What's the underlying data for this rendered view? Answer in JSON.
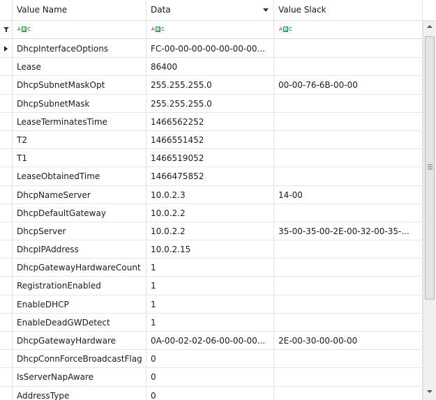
{
  "header": {
    "col_value_name": "Value Name",
    "col_data": "Data",
    "col_value_slack": "Value Slack"
  },
  "filter": {
    "letters": [
      "A",
      "B",
      "C"
    ]
  },
  "rows": [
    {
      "name": "DhcpInterfaceOptions",
      "data": "FC-00-00-00-00-00-00-00...",
      "slack": ""
    },
    {
      "name": "Lease",
      "data": "86400",
      "slack": ""
    },
    {
      "name": "DhcpSubnetMaskOpt",
      "data": "255.255.255.0",
      "slack": "00-00-76-6B-00-00"
    },
    {
      "name": "DhcpSubnetMask",
      "data": "255.255.255.0",
      "slack": ""
    },
    {
      "name": "LeaseTerminatesTime",
      "data": "1466562252",
      "slack": ""
    },
    {
      "name": "T2",
      "data": "1466551452",
      "slack": ""
    },
    {
      "name": "T1",
      "data": "1466519052",
      "slack": ""
    },
    {
      "name": "LeaseObtainedTime",
      "data": "1466475852",
      "slack": ""
    },
    {
      "name": "DhcpNameServer",
      "data": "10.0.2.3",
      "slack": "14-00"
    },
    {
      "name": "DhcpDefaultGateway",
      "data": "10.0.2.2",
      "slack": ""
    },
    {
      "name": "DhcpServer",
      "data": "10.0.2.2",
      "slack": "35-00-35-00-2E-00-32-00-35-..."
    },
    {
      "name": "DhcpIPAddress",
      "data": "10.0.2.15",
      "slack": ""
    },
    {
      "name": "DhcpGatewayHardwareCount",
      "data": "1",
      "slack": ""
    },
    {
      "name": "RegistrationEnabled",
      "data": "1",
      "slack": ""
    },
    {
      "name": "EnableDHCP",
      "data": "1",
      "slack": ""
    },
    {
      "name": "EnableDeadGWDetect",
      "data": "1",
      "slack": ""
    },
    {
      "name": "DhcpGatewayHardware",
      "data": "0A-00-02-02-06-00-00-00...",
      "slack": "2E-00-30-00-00-00"
    },
    {
      "name": "DhcpConnForceBroadcastFlag",
      "data": "0",
      "slack": ""
    },
    {
      "name": "IsServerNapAware",
      "data": "0",
      "slack": ""
    },
    {
      "name": "AddressType",
      "data": "0",
      "slack": ""
    }
  ]
}
